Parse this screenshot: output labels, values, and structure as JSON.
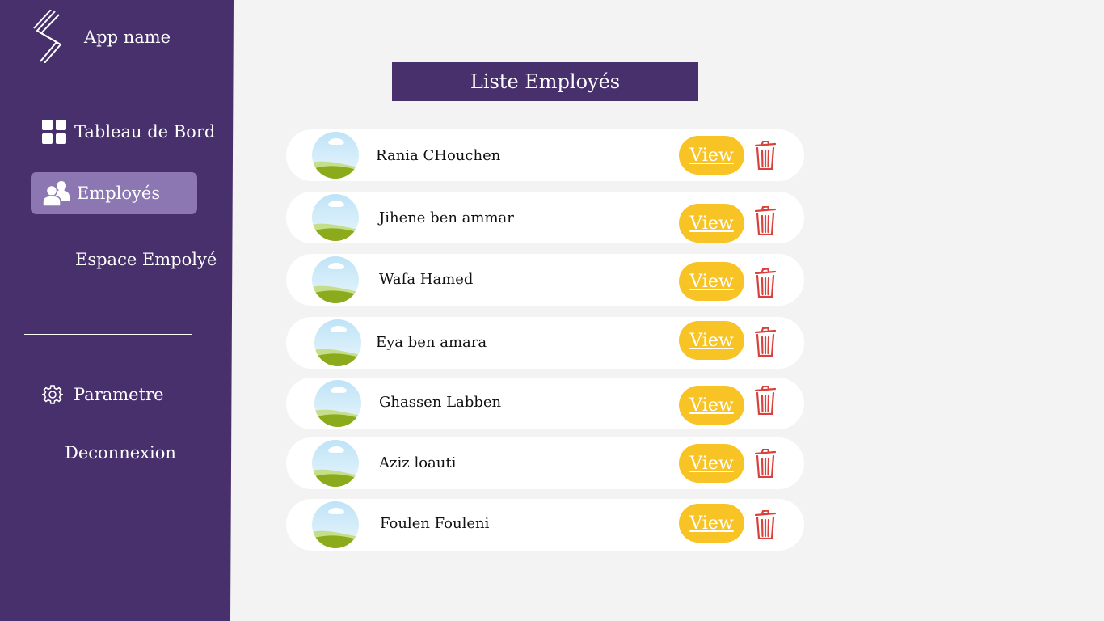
{
  "app": {
    "name": "App name"
  },
  "nav": {
    "dashboard": "Tableau de Bord",
    "employes": "Employés",
    "espace": "Espace Empolyé",
    "parametre": "Parametre",
    "deconnexion": "Deconnexion"
  },
  "main": {
    "title": "Liste Employés",
    "view_label": "View",
    "employees": [
      {
        "name": "Rania CHouchen"
      },
      {
        "name": "Jihene ben ammar"
      },
      {
        "name": "Wafa Hamed"
      },
      {
        "name": "Eya ben amara"
      },
      {
        "name": "Ghassen Labben"
      },
      {
        "name": "Aziz loauti"
      },
      {
        "name": "Foulen Fouleni"
      }
    ]
  },
  "colors": {
    "sidebar": "#47306b",
    "active_nav": "#8c77b3",
    "view_button": "#f7c325",
    "delete_icon": "#d9413c",
    "background": "#f3f3f3"
  }
}
